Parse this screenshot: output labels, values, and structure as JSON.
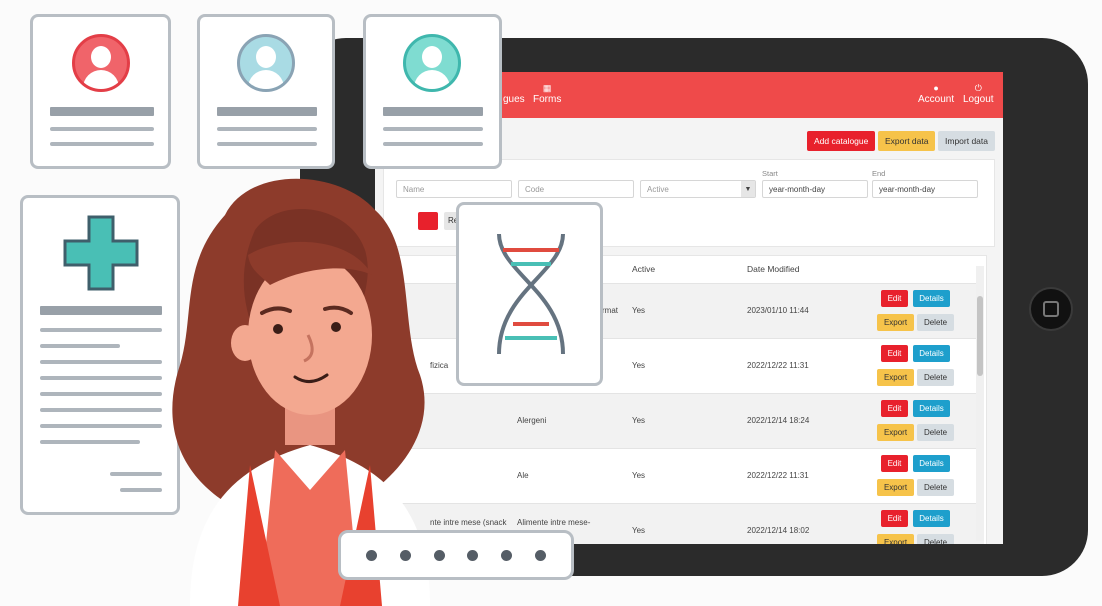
{
  "nav": {
    "catalogues": "gues",
    "forms": "Forms",
    "account": "Account",
    "logout": "Logout"
  },
  "toolbar": {
    "add_catalogue": "Add catalogue",
    "export_data": "Export data",
    "import_data": "Import data"
  },
  "filters": {
    "name_placeholder": "Name",
    "code_placeholder": "Code",
    "active_value": "Active",
    "start_label": "Start",
    "end_label": "End",
    "start_placeholder": "year-month-day",
    "end_placeholder": "year-month-day",
    "reset_fragment": "Re"
  },
  "table": {
    "headers": {
      "active": "Active",
      "date_modified": "Date Modified"
    },
    "rows": [
      {
        "name_fragment": "rmat",
        "active": "Yes",
        "date": "2023/01/10 11:44"
      },
      {
        "name_fragment": "fizica",
        "active": "Yes",
        "date": "2022/12/22 11:31"
      },
      {
        "name_fragment": "Alergeni",
        "active": "Yes",
        "date": "2022/12/14 18:24"
      },
      {
        "name_fragment": "Ale",
        "active": "Yes",
        "date": "2022/12/22 11:31"
      },
      {
        "code_fragment": "nte intre mese (snack",
        "name_fragment": "Alimente intre mese-",
        "active": "Yes",
        "date": "2022/12/14 18:02"
      }
    ],
    "actions": {
      "edit": "Edit",
      "details": "Details",
      "export": "Export",
      "delete": "Delete"
    }
  },
  "colors": {
    "brand_red": "#ef4a4a",
    "edit_red": "#e8212c",
    "details_blue": "#1e9fcc",
    "export_yellow": "#f6c34a",
    "delete_gray": "#d6dde2",
    "card_border": "#b8bec4",
    "cross_teal": "#49bfb5"
  },
  "icons": [
    "user-icon",
    "user-icon",
    "account-icon",
    "power-icon",
    "forms-icon",
    "medical-cross-icon",
    "dna-icon",
    "chevron-down-icon"
  ]
}
